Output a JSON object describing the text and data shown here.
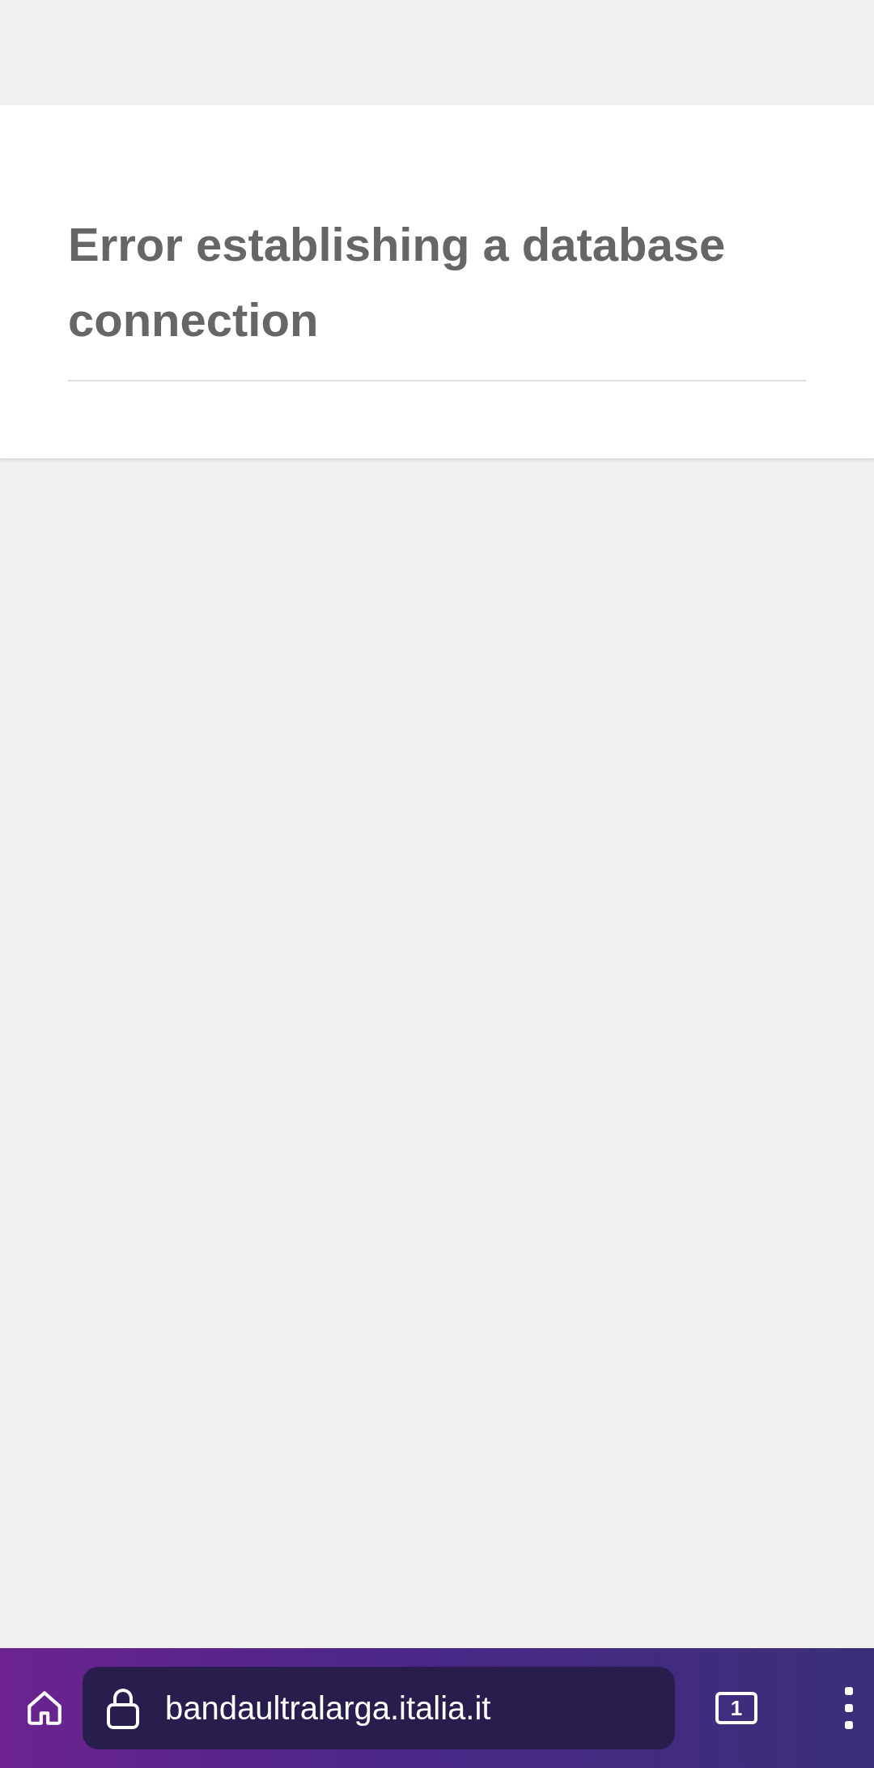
{
  "page": {
    "heading": "Error establishing a database connection"
  },
  "browser_bar": {
    "url": "bandaultralarga.italia.it",
    "tab_count": "1"
  }
}
